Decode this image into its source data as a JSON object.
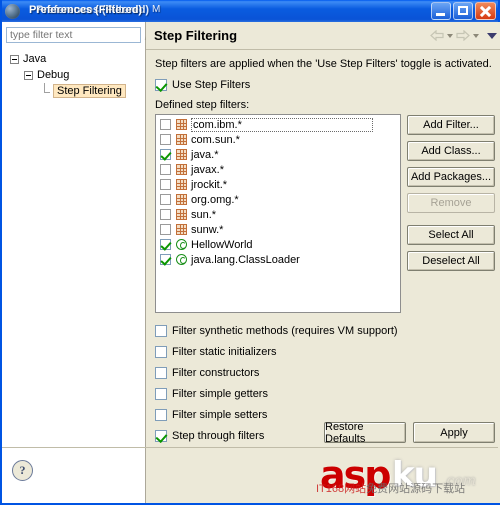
{
  "window": {
    "title": "Preferences (Filtered)",
    "title_ghost": "Preferences (Filtered)",
    "title_artifact": "M",
    "icon": "app-sphere-icon",
    "controls": {
      "minimize": "minimize-button",
      "maximize": "maximize-button",
      "close": "close-button"
    }
  },
  "sidebar": {
    "filter": {
      "placeholder": "type filter text",
      "value": "",
      "clear_icon": "eraser-icon"
    },
    "tree": [
      {
        "label": "Java",
        "level": 1,
        "expanded": true,
        "selected": false
      },
      {
        "label": "Debug",
        "level": 2,
        "expanded": true,
        "selected": false
      },
      {
        "label": "Step Filtering",
        "level": 3,
        "expanded": false,
        "selected": true
      }
    ]
  },
  "pane": {
    "title": "Step Filtering",
    "nav": {
      "back_icon": "back-arrow-icon",
      "back_menu_icon": "chevron-down-icon",
      "forward_icon": "forward-arrow-icon",
      "forward_menu_icon": "chevron-down-icon",
      "menu_icon": "view-menu-icon"
    },
    "description": "Step filters are applied when the 'Use Step Filters' toggle is activated.",
    "use_step_filters": {
      "label": "Use Step Filters",
      "checked": true
    },
    "defined_label": "Defined step filters:",
    "filters": [
      {
        "text": "com.ibm.*",
        "checked": false,
        "icon": "package-icon",
        "focused": true
      },
      {
        "text": "com.sun.*",
        "checked": false,
        "icon": "package-icon",
        "focused": false
      },
      {
        "text": "java.*",
        "checked": true,
        "icon": "package-icon",
        "focused": false
      },
      {
        "text": "javax.*",
        "checked": false,
        "icon": "package-icon",
        "focused": false
      },
      {
        "text": "jrockit.*",
        "checked": false,
        "icon": "package-icon",
        "focused": false
      },
      {
        "text": "org.omg.*",
        "checked": false,
        "icon": "package-icon",
        "focused": false
      },
      {
        "text": "sun.*",
        "checked": false,
        "icon": "package-icon",
        "focused": false
      },
      {
        "text": "sunw.*",
        "checked": false,
        "icon": "package-icon",
        "focused": false
      },
      {
        "text": "HellowWorld",
        "checked": true,
        "icon": "class-icon",
        "focused": false
      },
      {
        "text": "java.lang.ClassLoader",
        "checked": true,
        "icon": "class-icon",
        "focused": false
      }
    ],
    "buttons": [
      {
        "label": "Add Filter...",
        "enabled": true
      },
      {
        "label": "Add Class...",
        "enabled": true
      },
      {
        "label": "Add Packages...",
        "enabled": true
      },
      {
        "label": "Remove",
        "enabled": false
      },
      {
        "label": "Select All",
        "enabled": true
      },
      {
        "label": "Deselect All",
        "enabled": true
      }
    ],
    "options": [
      {
        "label": "Filter synthetic methods (requires VM support)",
        "checked": false
      },
      {
        "label": "Filter static initializers",
        "checked": false
      },
      {
        "label": "Filter constructors",
        "checked": false
      },
      {
        "label": "Filter simple getters",
        "checked": false
      },
      {
        "label": "Filter simple setters",
        "checked": false
      },
      {
        "label": "Step through filters",
        "checked": true
      }
    ],
    "actions": {
      "restore_defaults": "Restore Defaults",
      "apply": "Apply"
    },
    "help_icon": "help-question-icon"
  },
  "watermark": {
    "brand_red": "asp",
    "brand_white": "ku",
    "brand_domain": ".com",
    "subtitle_prefix": "IT168网站",
    "subtitle_rest": "免费网站源码下载站"
  }
}
